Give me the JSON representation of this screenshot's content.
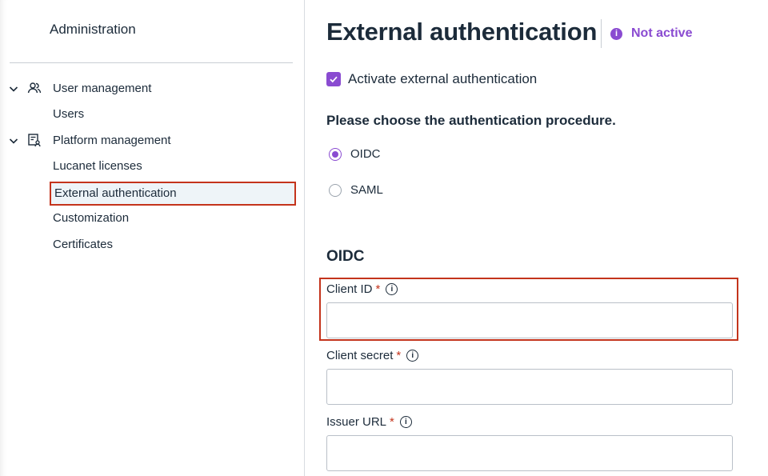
{
  "sidebar": {
    "title": "Administration",
    "groups": [
      {
        "label": "User management",
        "icon": "users-icon",
        "items": [
          "Users"
        ]
      },
      {
        "label": "Platform management",
        "icon": "platform-settings-icon",
        "items": [
          "Lucanet licenses",
          "External authentication",
          "Customization",
          "Certificates"
        ]
      }
    ],
    "active_item": "External authentication"
  },
  "main": {
    "title": "External authentication",
    "status": {
      "text": "Not active",
      "icon": "info-icon",
      "color": "#8a4bd1"
    },
    "activate": {
      "label": "Activate external authentication",
      "checked": true
    },
    "procedure_prompt": "Please choose the authentication procedure.",
    "procedures": [
      {
        "label": "OIDC",
        "selected": true
      },
      {
        "label": "SAML",
        "selected": false
      }
    ],
    "section_title": "OIDC",
    "fields": [
      {
        "label": "Client ID",
        "required": "*",
        "value": ""
      },
      {
        "label": "Client secret",
        "required": "*",
        "value": ""
      },
      {
        "label": "Issuer URL",
        "required": "*",
        "value": ""
      }
    ]
  },
  "colors": {
    "accent": "#8a4bd1",
    "highlight": "#c4341c",
    "text": "#1c2b3a"
  }
}
